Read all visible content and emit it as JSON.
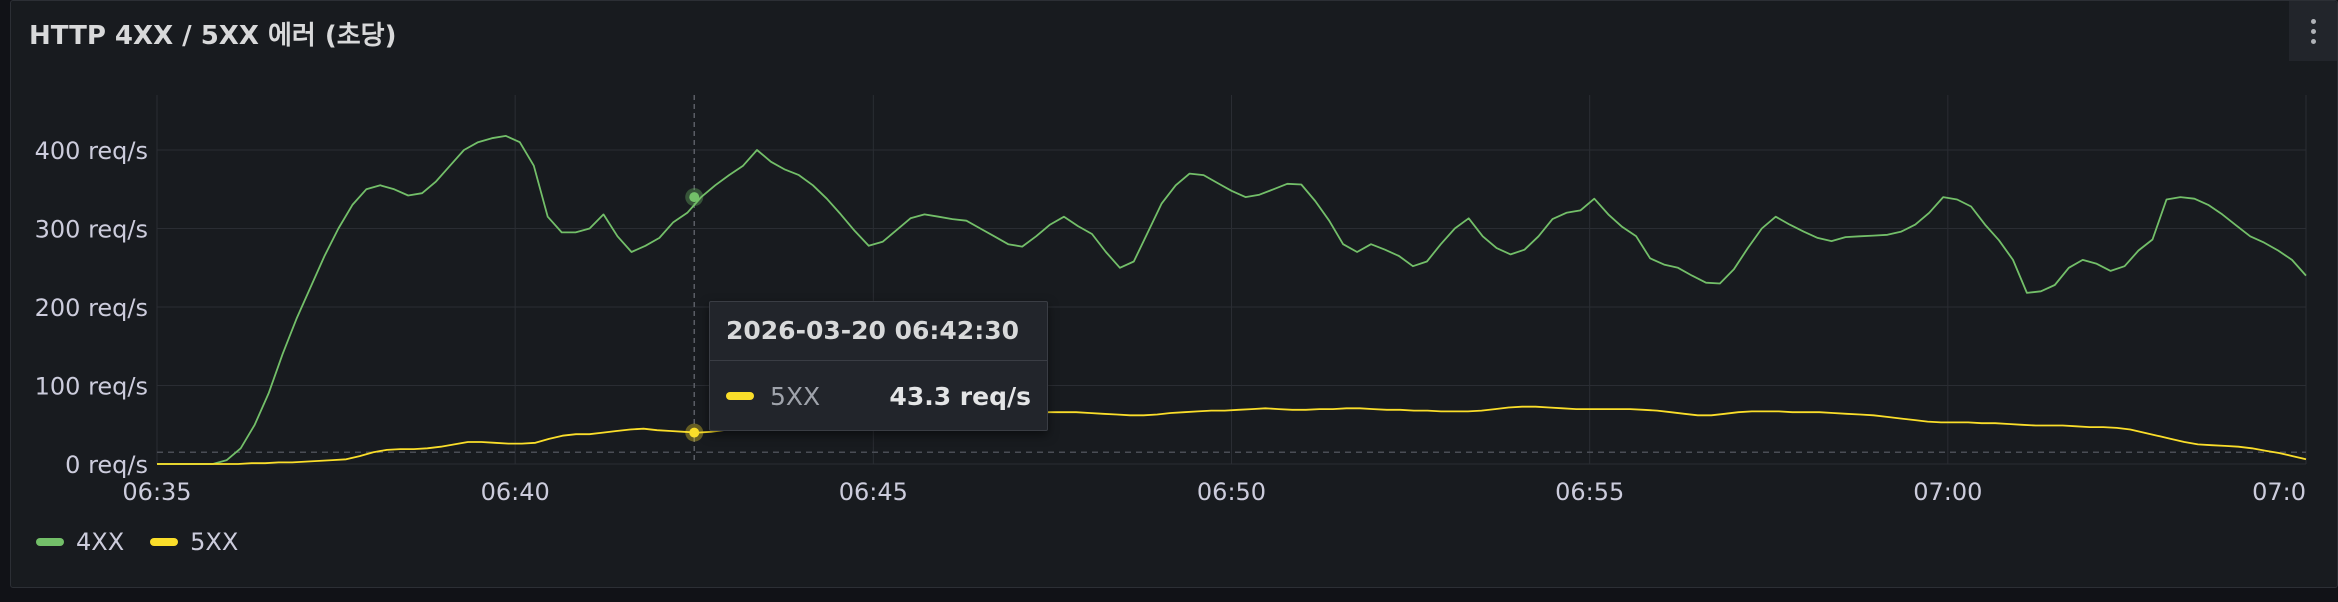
{
  "panel": {
    "title": "HTTP 4XX / 5XX 에러 (초당)"
  },
  "chart_data": {
    "type": "line",
    "title": "HTTP 4XX / 5XX 에러 (초당)",
    "x_ticks": [
      "06:35",
      "06:40",
      "06:45",
      "06:50",
      "06:55",
      "07:00",
      "07:0"
    ],
    "x_range_minutes": [
      0,
      30
    ],
    "y_ticks": [
      "0 req/s",
      "100 req/s",
      "200 req/s",
      "300 req/s",
      "400 req/s"
    ],
    "ylim": [
      0,
      400
    ],
    "grid": true,
    "threshold_line": 15,
    "legend_position": "bottom-left",
    "series": [
      {
        "name": "4XX",
        "color": "#73bf69",
        "values": [
          0,
          0,
          0,
          0,
          0,
          5,
          20,
          50,
          90,
          140,
          185,
          225,
          265,
          300,
          330,
          350,
          355,
          350,
          342,
          345,
          360,
          380,
          400,
          410,
          415,
          418,
          410,
          380,
          315,
          295,
          295,
          300,
          318,
          290,
          270,
          278,
          288,
          308,
          320,
          340,
          355,
          368,
          380,
          400,
          385,
          375,
          368,
          355,
          338,
          318,
          297,
          278,
          283,
          298,
          313,
          318,
          315,
          312,
          310,
          300,
          290,
          280,
          277,
          290,
          305,
          315,
          303,
          293,
          270,
          250,
          258,
          295,
          332,
          355,
          370,
          368,
          358,
          348,
          340,
          343,
          350,
          357,
          356,
          335,
          310,
          280,
          270,
          280,
          273,
          265,
          252,
          258,
          280,
          300,
          313,
          290,
          275,
          267,
          273,
          290,
          312,
          320,
          323,
          338,
          318,
          302,
          290,
          262,
          254,
          250,
          240,
          231,
          230,
          248,
          275,
          300,
          315,
          305,
          296,
          288,
          284,
          289,
          290,
          291,
          292,
          296,
          305,
          320,
          340,
          337,
          328,
          305,
          285,
          260,
          218,
          220,
          228,
          250,
          260,
          255,
          246,
          252,
          272,
          286,
          337,
          340,
          338,
          330,
          318,
          304,
          290,
          282,
          272,
          260,
          240
        ]
      },
      {
        "name": "5XX",
        "color": "#fade2a",
        "values": [
          0,
          0,
          0,
          0,
          0,
          0,
          0,
          1,
          1,
          2,
          2,
          3,
          4,
          5,
          6,
          10,
          15,
          18,
          19,
          19,
          20,
          22,
          25,
          28,
          28,
          27,
          26,
          26,
          27,
          32,
          36,
          38,
          38,
          40,
          42,
          44,
          45,
          43,
          42,
          41,
          40,
          41,
          43.3,
          45,
          49,
          52,
          54,
          55,
          56,
          57,
          58,
          59,
          58,
          58,
          59,
          60,
          61,
          62,
          63,
          64,
          64,
          63,
          62,
          63,
          64,
          65,
          66,
          66,
          66,
          65,
          64,
          63,
          62,
          62,
          63,
          65,
          66,
          67,
          68,
          68,
          69,
          70,
          71,
          70,
          69,
          69,
          70,
          70,
          71,
          71,
          70,
          69,
          69,
          68,
          68,
          67,
          67,
          67,
          68,
          70,
          72,
          73,
          73,
          72,
          71,
          70,
          70,
          70,
          70,
          70,
          69,
          68,
          66,
          64,
          62,
          62,
          64,
          66,
          67,
          67,
          67,
          66,
          66,
          66,
          65,
          64,
          63,
          62,
          60,
          58,
          56,
          54,
          53,
          53,
          53,
          52,
          52,
          51,
          50,
          49,
          49,
          49,
          48,
          47,
          47,
          46,
          44,
          40,
          36,
          32,
          28,
          25,
          24,
          23,
          22,
          20,
          17,
          14,
          10,
          6
        ]
      }
    ],
    "tooltip": {
      "time": "2026-03-20 06:42:30",
      "series": "5XX",
      "value": "43.3 req/s"
    }
  }
}
